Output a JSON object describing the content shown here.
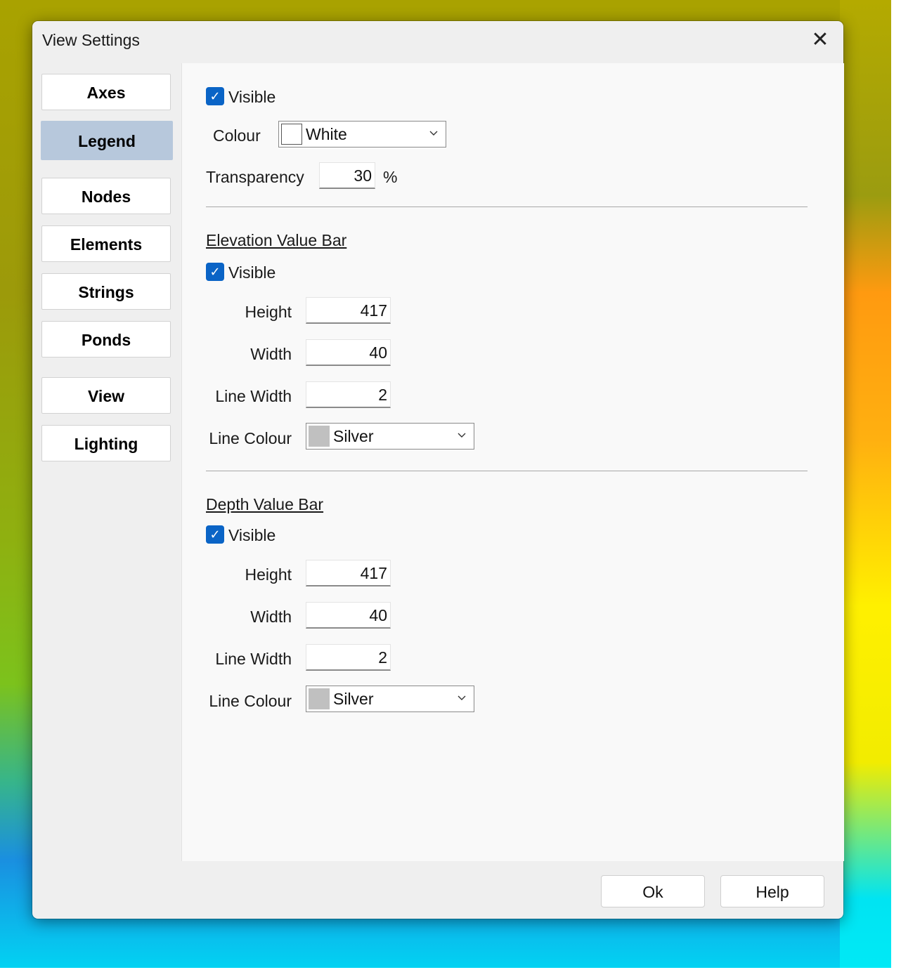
{
  "dialog": {
    "title": "View Settings",
    "close_glyph": "✕"
  },
  "nav": {
    "items": [
      "Axes",
      "Legend",
      "Nodes",
      "Elements",
      "Strings",
      "Ponds",
      "View",
      "Lighting"
    ],
    "selected": "Legend"
  },
  "legend": {
    "visible_label": "Visible",
    "visible_checked": true,
    "colour_label": "Colour",
    "colour_value": "White",
    "colour_swatch": "#ffffff",
    "transparency_label": "Transparency",
    "transparency_value": "30",
    "transparency_unit": "%"
  },
  "elevation_bar": {
    "title": "Elevation Value Bar",
    "visible_label": "Visible",
    "visible_checked": true,
    "height_label": "Height",
    "height_value": "417",
    "width_label": "Width",
    "width_value": "40",
    "line_width_label": "Line Width",
    "line_width_value": "2",
    "line_colour_label": "Line Colour",
    "line_colour_value": "Silver",
    "line_colour_swatch": "#c0c0c0"
  },
  "depth_bar": {
    "title": "Depth Value Bar",
    "visible_label": "Visible",
    "visible_checked": true,
    "height_label": "Height",
    "height_value": "417",
    "width_label": "Width",
    "width_value": "40",
    "line_width_label": "Line Width",
    "line_width_value": "2",
    "line_colour_label": "Line Colour",
    "line_colour_value": "Silver",
    "line_colour_swatch": "#c0c0c0"
  },
  "footer": {
    "ok_label": "Ok",
    "help_label": "Help"
  },
  "icons": {
    "checkmark": "check-icon",
    "dropdown": "chevron-down-icon",
    "close": "close-icon"
  }
}
